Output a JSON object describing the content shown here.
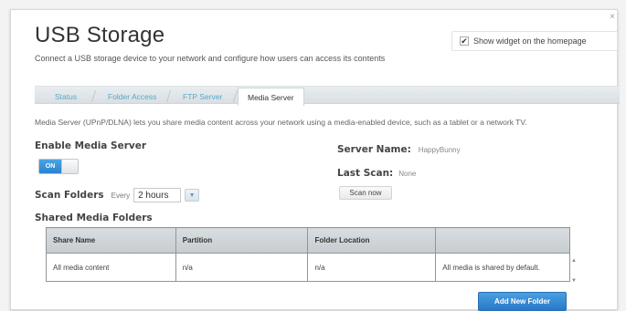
{
  "page": {
    "title": "USB Storage",
    "subtitle": "Connect a USB storage device to your network and configure how users can access its contents",
    "close_glyph": "×"
  },
  "widget": {
    "label": "Show widget on the homepage",
    "checked": true,
    "check_glyph": "✔"
  },
  "tabs": [
    {
      "label": "Status",
      "active": false
    },
    {
      "label": "Folder Access",
      "active": false
    },
    {
      "label": "FTP Server",
      "active": false
    },
    {
      "label": "Media Server",
      "active": true
    }
  ],
  "media_server": {
    "description": "Media Server (UPnP/DLNA) lets you share media content across your network using a media-enabled device, such as a tablet or a network TV.",
    "enable_label": "Enable Media Server",
    "toggle_label": "ON",
    "toggle_on": true,
    "scan_label": "Scan Folders",
    "every_label": "Every",
    "interval_value": "2 hours",
    "server_name_label": "Server Name:",
    "server_name_value": "HappyBunny",
    "last_scan_label": "Last Scan:",
    "last_scan_value": "None",
    "scan_now_label": "Scan now"
  },
  "shared": {
    "title": "Shared Media Folders",
    "columns": [
      "Share Name",
      "Partition",
      "Folder Location",
      ""
    ],
    "rows": [
      [
        "All media content",
        "n/a",
        "n/a",
        "All media is shared by default."
      ]
    ],
    "add_button_label": "Add New Folder"
  },
  "colors": {
    "accent": "#2b83cf",
    "tab_link": "#58a8c8"
  },
  "icons": {
    "dropdown": "chevron-down-icon",
    "close": "close-icon"
  }
}
